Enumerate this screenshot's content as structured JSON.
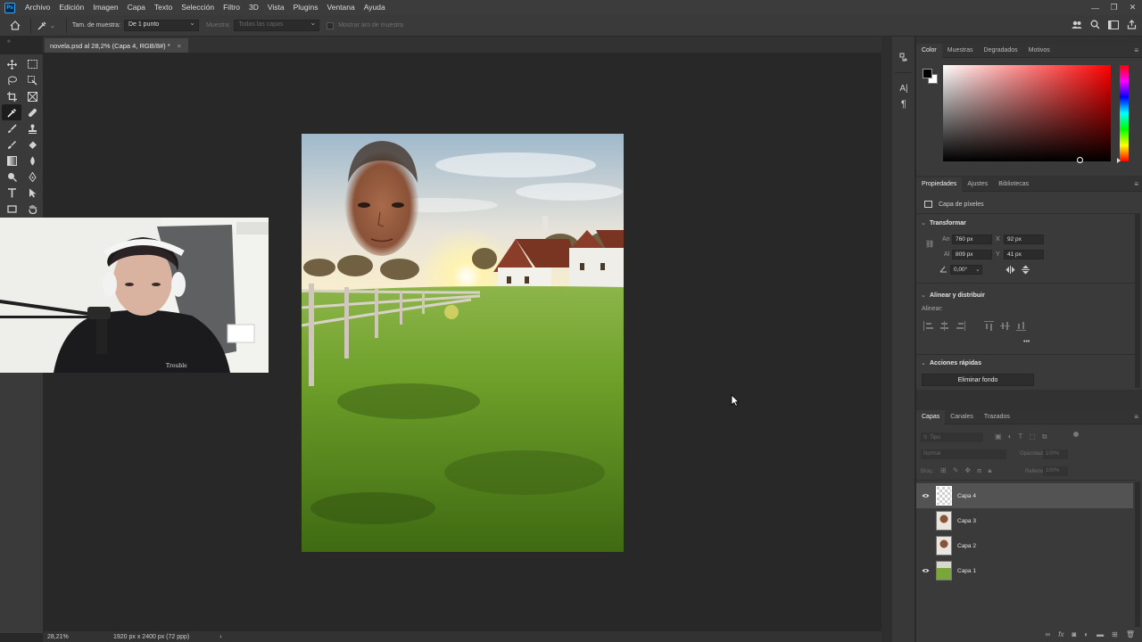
{
  "app": {
    "logo": "Ps"
  },
  "menu": {
    "items": [
      "Archivo",
      "Edición",
      "Imagen",
      "Capa",
      "Texto",
      "Selección",
      "Filtro",
      "3D",
      "Vista",
      "Plugins",
      "Ventana",
      "Ayuda"
    ]
  },
  "window_controls": {
    "minimize": "—",
    "restore": "❐",
    "close": "✕"
  },
  "options": {
    "sample_size_label": "Tam. de muestra:",
    "sample_size_value": "De 1 punto",
    "sample_label": "Muestra:",
    "sample_value": "Todas las capas",
    "show_ring_label": "Mostrar aro de muestra"
  },
  "document": {
    "tab_title": "novela.psd al 28,2% (Capa 4, RGB/8#) *",
    "close": "×"
  },
  "status": {
    "zoom": "28,21%",
    "doc_info": "1920 px x 2400 px (72 ppp)",
    "arrow": "›"
  },
  "color_panel": {
    "tabs": [
      "Color",
      "Muestras",
      "Degradados",
      "Motivos"
    ],
    "foreground": "#000000",
    "background": "#ffffff",
    "hue": "#ff0000"
  },
  "properties_panel": {
    "tabs": [
      "Propiedades",
      "Ajustes",
      "Bibliotecas"
    ],
    "layer_type": "Capa de píxeles",
    "transform_title": "Transformar",
    "w_label": "An",
    "w_value": "760 px",
    "h_label": "Al",
    "h_value": "809 px",
    "x_label": "X",
    "x_value": "92 px",
    "y_label": "Y",
    "y_value": "41 px",
    "angle_value": "0,00°",
    "align_title": "Alinear y distribuir",
    "align_label": "Alinear:",
    "quick_title": "Acciones rápidas",
    "remove_bg": "Eliminar fondo",
    "more": "•••"
  },
  "layers_panel": {
    "tabs": [
      "Capas",
      "Canales",
      "Trazados"
    ],
    "filter_placeholder": "Tipo",
    "blend_mode": "Normal",
    "opacity_label": "Opacidad:",
    "opacity_value": "100%",
    "lock_label": "Bloq.:",
    "fill_label": "Relleno:",
    "fill_value": "100%",
    "layers": [
      {
        "name": "Capa 4",
        "visible": true,
        "selected": true
      },
      {
        "name": "Capa 3",
        "visible": false,
        "selected": false
      },
      {
        "name": "Capa 2",
        "visible": false,
        "selected": false
      },
      {
        "name": "Capa 1",
        "visible": true,
        "selected": false
      }
    ]
  },
  "webcam": {
    "hoodie_text": "Trouble"
  }
}
